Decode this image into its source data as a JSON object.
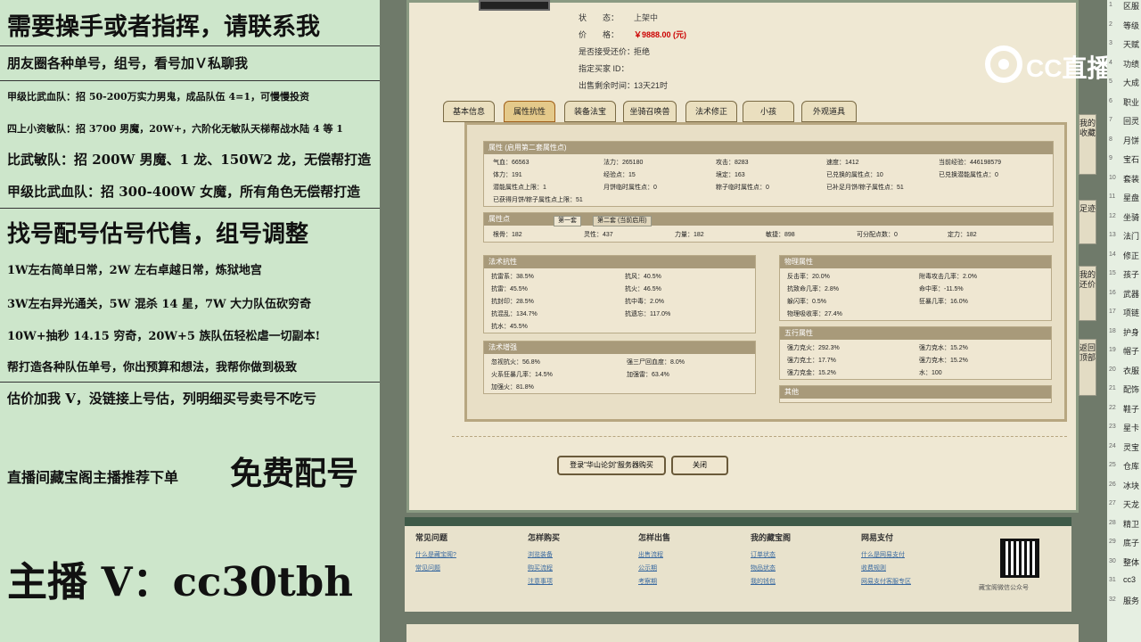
{
  "overlay": {
    "l1": "需要操手或者指挥，请联系我",
    "l2": "朋友圈各种单号，组号，看号加Ｖ私聊我",
    "l3": "甲级比武血队：招 50-200万实力男鬼，成品队伍 4=1，可慢慢投资",
    "l4": "四上小资敏队：招 3700 男魔，20W+，六阶化无敏队天梯帮战水陆 4 等 1",
    "l5": "比武敏队：招 200W 男魔、1 龙、150W2 龙，无偿帮打造",
    "l6": "甲级比武血队：招 300-400W 女魔，所有角色无偿帮打造",
    "l7": "找号配号估号代售，组号调整",
    "l8": "1W左右简单日常，2W 左右卓越日常，炼狱地宫",
    "l9": "3W左右异光通关，5W 混杀 14 星，7W 大力队伍砍穷奇",
    "l10": "10W+抽秒 14.15 穷奇，20W+5 族队伍轻松虐一切副本!",
    "l11": "帮打造各种队伍单号，你出预算和想法，我帮你做到极致",
    "l12": "估价加我 V，没链接上号估，列明细买号卖号不吃亏",
    "l13a": "直播间藏宝阁主播推荐下单",
    "l13b": "免费配号",
    "l14": "主播 V：cc30tbh"
  },
  "info": {
    "status_label": "状　　态：",
    "status": "上架中",
    "price_label": "价　　格：",
    "price": "￥9888.00 (元)",
    "bargain_label": "是否接受还价：",
    "bargain": "拒绝",
    "buyer_label": "指定买家 ID：",
    "buyer": "",
    "time_label": "出售剩余时间：",
    "time": "13天21时"
  },
  "logo": "CC直播",
  "tabs": [
    "基本信息",
    "属性抗性",
    "装备法宝",
    "坐骑召唤兽",
    "法术修正",
    "小孩",
    "外观道具"
  ],
  "attr": {
    "title": "属性 (启用第二套属性点)",
    "rows": [
      [
        "气血：66563",
        "法力：265180",
        "攻击：8283",
        "速度：1412",
        "当前经验：446198579"
      ],
      [
        "体力：191",
        "经验点：15",
        "境定：163",
        "已兑换的属性点：10",
        "已兑换潜能属性点：0"
      ],
      [
        "潜能属性点上限：1",
        "月饼临时属性点：0",
        "粽子临时属性点：0",
        "已补足月饼/粽子属性点：51",
        ""
      ],
      [
        "已获得月饼/粽子属性点上限：51",
        "",
        "",
        "",
        ""
      ]
    ]
  },
  "points": {
    "title": "属性点",
    "tab1": "第一套",
    "tab2": "第二套 (当前启用)",
    "items": [
      "根骨：182",
      "灵性：437",
      "力量：182",
      "敏捷：898",
      "可分配点数：0",
      "定力：182"
    ]
  },
  "resist": {
    "title": "法术抗性",
    "items": [
      "抗雷系：38.5%",
      "抗风：40.5%",
      "抗雷：45.5%",
      "抗火：46.5%",
      "抗封印：28.5%",
      "抗中毒：2.0%",
      "抗混乱：134.7%",
      "抗遗忘：117.0%",
      "抗水：45.5%",
      ""
    ]
  },
  "boost": {
    "title": "法术增强",
    "items": [
      "忽视抗火：56.8%",
      "强三尸回血度：8.0%",
      "火系狂暴几率：14.5%",
      "加强雷：63.4%",
      "加强火：81.8%",
      ""
    ]
  },
  "phys": {
    "title": "物理属性",
    "items": [
      "反击率：20.0%",
      "附毒攻击几率：2.0%",
      "抗致命几率：2.8%",
      "命中率：-11.5%",
      "躲闪率：0.5%",
      "狂暴几率：16.0%",
      "物理吸收率：27.4%",
      ""
    ]
  },
  "five": {
    "title": "五行属性",
    "items": [
      "强力克火：292.3%",
      "强力克水：15.2%",
      "强力克土：17.7%",
      "强力克木：15.2%",
      "强力克金：15.2%",
      "水：100"
    ]
  },
  "other": {
    "title": "其他"
  },
  "buttons": {
    "buy": "登录\"华山论剑\"服务器购买",
    "close": "关闭"
  },
  "footer": {
    "cols": [
      {
        "title": "常见问题",
        "links": [
          "什么是藏宝阁?",
          "常见问题"
        ]
      },
      {
        "title": "怎样购买",
        "links": [
          "浏览装备",
          "购买流程",
          "注意事项"
        ]
      },
      {
        "title": "怎样出售",
        "links": [
          "出售流程",
          "公示期",
          "考察期"
        ]
      },
      {
        "title": "我的藏宝阁",
        "links": [
          "订单状态",
          "物品状态",
          "我的钱包"
        ]
      },
      {
        "title": "网易支付",
        "links": [
          "什么是网易支付",
          "收费规则",
          "网易支付客服专区"
        ]
      }
    ],
    "qr_label": "藏宝阁微信公众号"
  },
  "side": {
    "fav": "我的收藏",
    "foot": "足迹",
    "bargain": "我的还价",
    "top": "返回顶部"
  },
  "right_lines": [
    "区服",
    "等级",
    "天赋",
    "功绩",
    "大成",
    "职业",
    "回灵",
    "月饼",
    "宝石",
    "套装",
    "星盘",
    "坐骑",
    "法门",
    "修正",
    "孩子",
    "武器",
    "项链",
    "护身",
    "帽子",
    "衣服",
    "配饰",
    "鞋子",
    "星卡",
    "灵宝",
    "仓库",
    "冰块",
    "天龙",
    "精卫",
    "底子",
    "整体",
    "cc3",
    "服务"
  ],
  "colors": {
    "accent": "#a0601a",
    "price": "#cc0000",
    "bg": "#cde6cb"
  }
}
